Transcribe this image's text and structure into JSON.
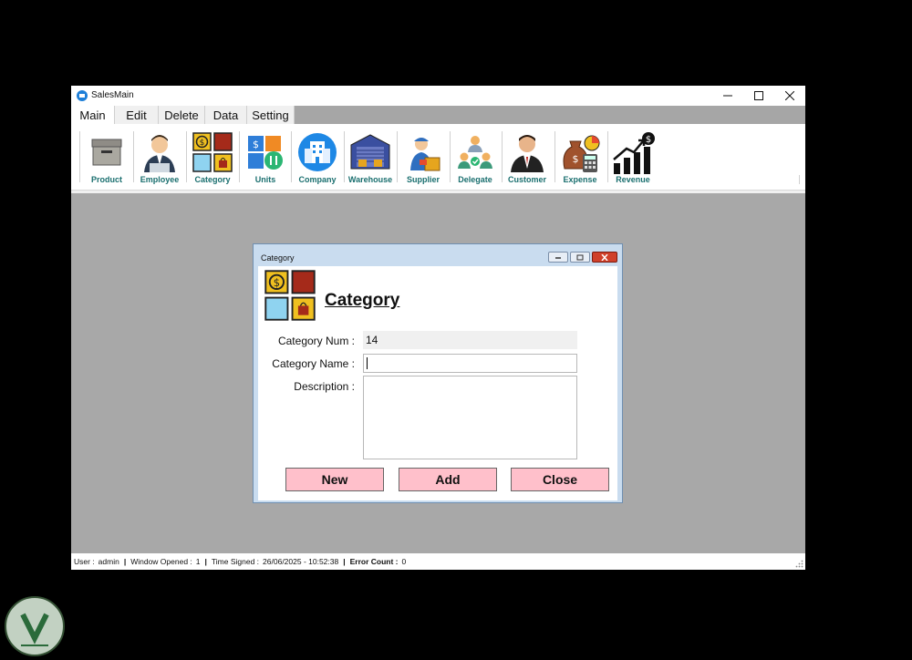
{
  "window": {
    "title": "SalesMain",
    "controls": {
      "minimize": "—",
      "maximize": "☐",
      "close": "✕"
    }
  },
  "tabs": [
    {
      "label": "Main",
      "active": true
    },
    {
      "label": "Edit",
      "active": false
    },
    {
      "label": "Delete",
      "active": false
    },
    {
      "label": "Data",
      "active": false
    },
    {
      "label": "Setting",
      "active": false
    }
  ],
  "ribbon": {
    "items": [
      {
        "label": "Product",
        "icon": "box-icon"
      },
      {
        "label": "Employee",
        "icon": "employee-icon"
      },
      {
        "label": "Category",
        "icon": "category-icon"
      },
      {
        "label": "Units",
        "icon": "units-icon"
      },
      {
        "label": "Company",
        "icon": "company-icon"
      },
      {
        "label": "Warehouse",
        "icon": "warehouse-icon"
      },
      {
        "label": "Supplier",
        "icon": "supplier-icon"
      },
      {
        "label": "Delegate",
        "icon": "delegate-icon"
      },
      {
        "label": "Customer",
        "icon": "customer-icon"
      },
      {
        "label": "Expense",
        "icon": "expense-icon"
      },
      {
        "label": "Revenue",
        "icon": "revenue-icon"
      }
    ]
  },
  "dialog": {
    "title": "Category",
    "heading": "Category",
    "fields": {
      "num_label": "Category Num :",
      "num_value": "14",
      "name_label": "Category Name :",
      "name_value": "",
      "desc_label": "Description :",
      "desc_value": ""
    },
    "buttons": {
      "new": "New",
      "add": "Add",
      "close": "Close"
    }
  },
  "status": {
    "user_label": "User :",
    "user": "admin",
    "window_label": "Window Opened :",
    "window_count": "1",
    "time_label": "Time Signed :",
    "time": "26/06/2025 - 10:52:38",
    "error_label": "Error Count :",
    "error_count": "0",
    "separator": "|"
  },
  "colors": {
    "accent_label": "#1a6f6f",
    "button_bg": "#ffc0cb",
    "mdi_bg": "#a8a8a8",
    "dialog_frame": "#c9dcef"
  }
}
